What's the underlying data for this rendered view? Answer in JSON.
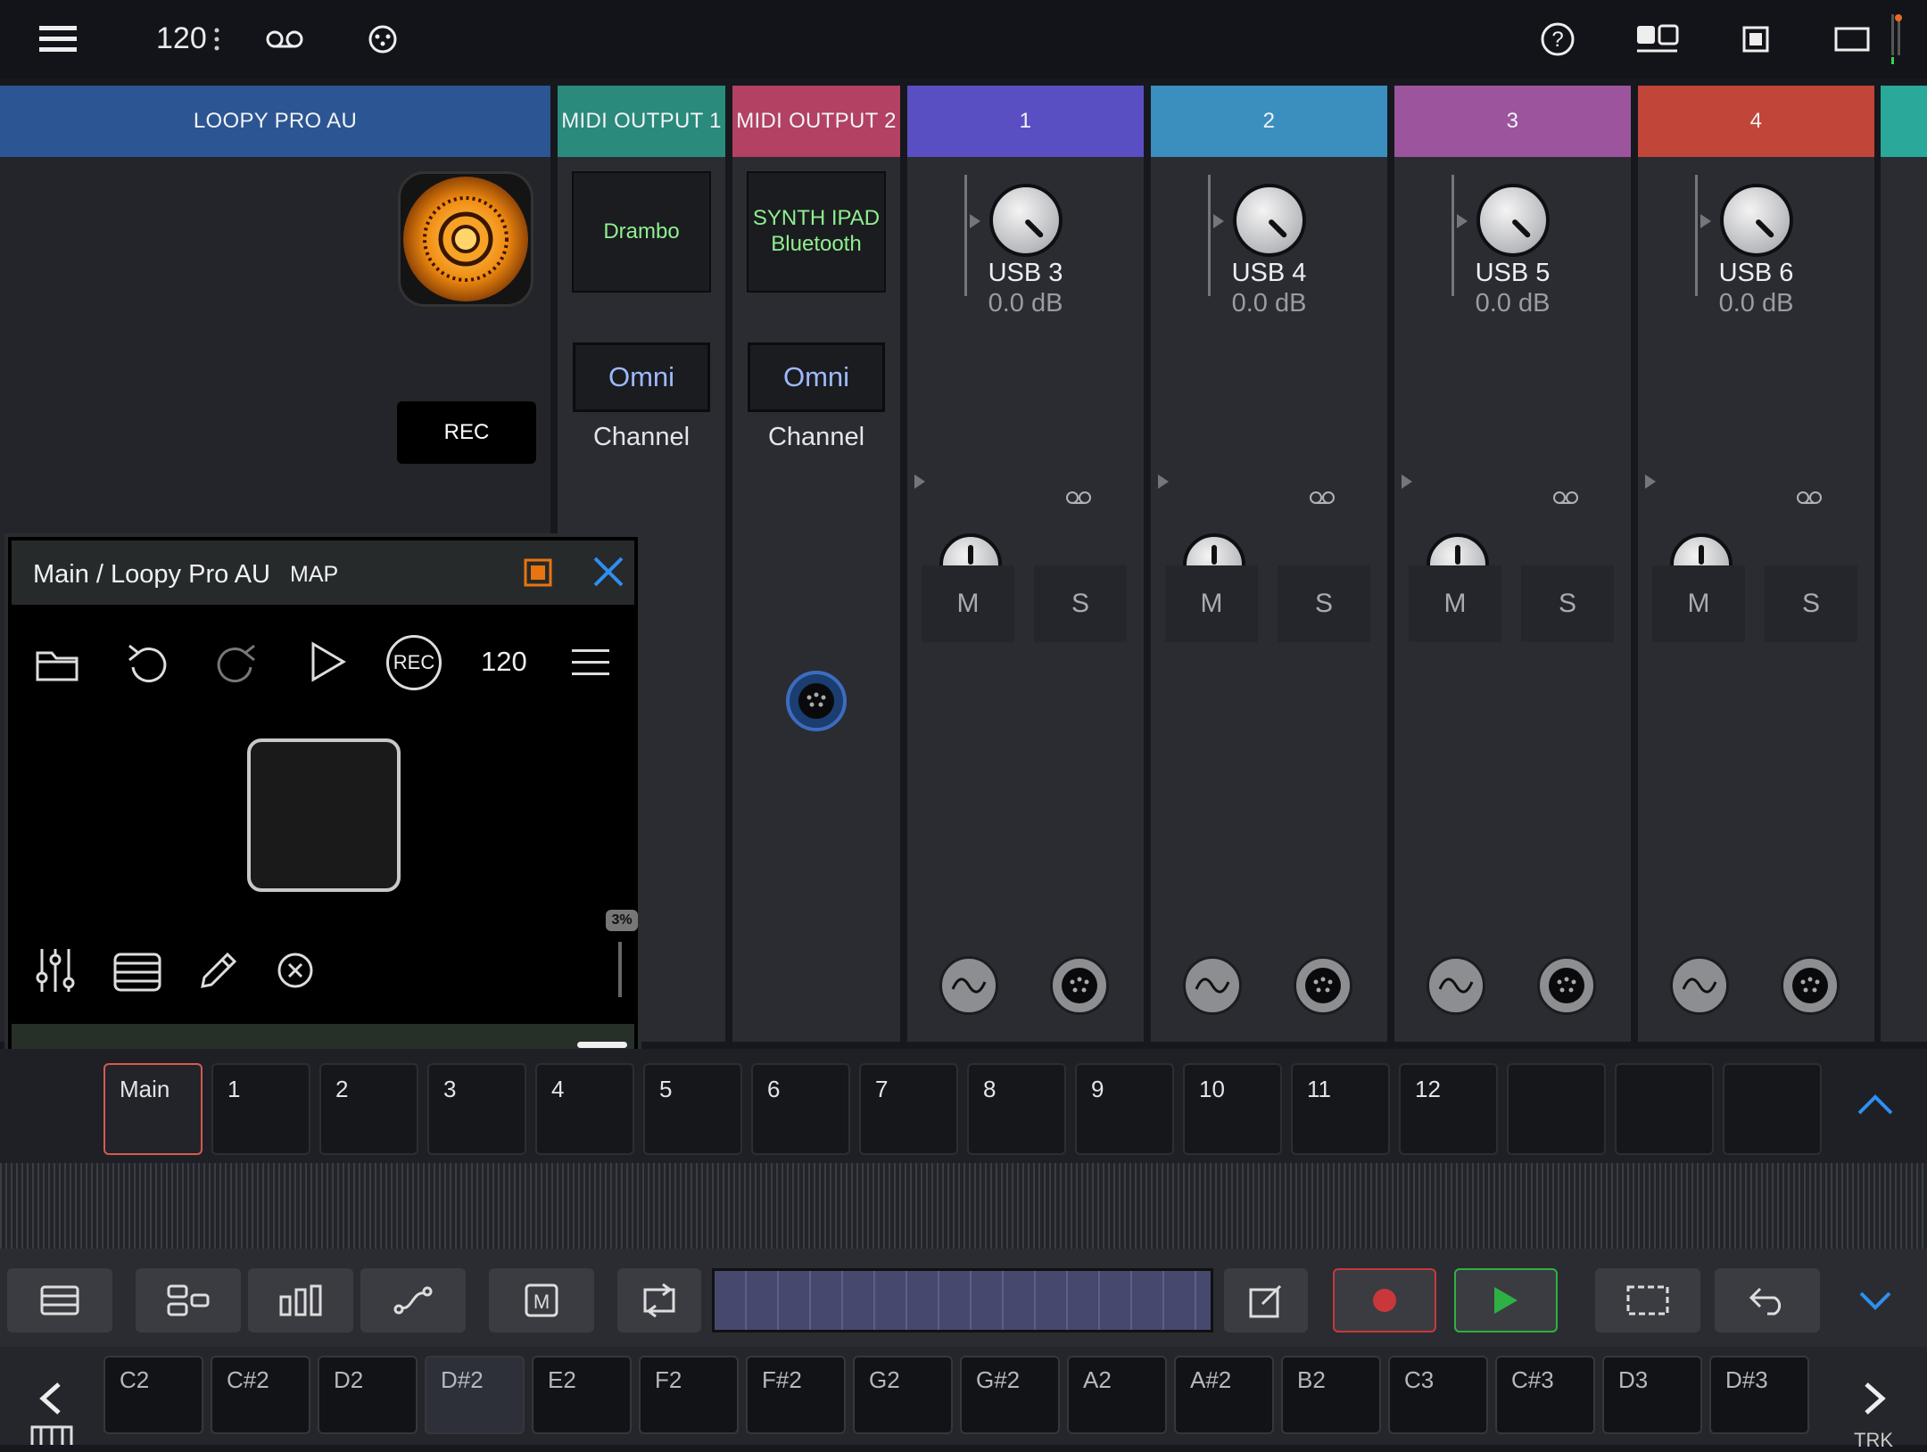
{
  "topbar": {
    "bpm": "120",
    "icons": [
      "menu-icon",
      "bpm-more-icon",
      "loop-icon",
      "dial-icon",
      "help-icon",
      "layout-icon",
      "single-view-icon",
      "fullscreen-icon"
    ]
  },
  "strips": {
    "au": {
      "title": "LOOPY PRO AU",
      "rec_label": "REC"
    },
    "midi1": {
      "title": "MIDI OUTPUT 1",
      "device": "Drambo",
      "channel_value": "Omni",
      "channel_label": "Channel",
      "color": "#2a8a7c"
    },
    "midi2": {
      "title": "MIDI OUTPUT 2",
      "device_line1": "SYNTH IPAD",
      "device_line2": "Bluetooth",
      "channel_value": "Omni",
      "channel_label": "Channel",
      "color": "#b24163"
    },
    "channels": [
      {
        "num": "1",
        "input": "USB 3",
        "gain": "0.0 dB",
        "pan": "Pan",
        "mute": "M",
        "solo": "S",
        "color": "#5a4fc2"
      },
      {
        "num": "2",
        "input": "USB 4",
        "gain": "0.0 dB",
        "pan": "Pan",
        "mute": "M",
        "solo": "S",
        "color": "#3a8fbf"
      },
      {
        "num": "3",
        "input": "USB 5",
        "gain": "0.0 dB",
        "pan": "Pan",
        "mute": "M",
        "solo": "S",
        "color": "#9c549c"
      },
      {
        "num": "4",
        "input": "USB 6",
        "gain": "0.0 dB",
        "pan": "Pan",
        "mute": "M",
        "solo": "S",
        "color": "#c2453a"
      }
    ]
  },
  "plugin": {
    "title": "Main / Loopy Pro AU",
    "map": "MAP",
    "bpm": "120",
    "rec": "REC",
    "percent": "3%"
  },
  "scenes": [
    "Main",
    "1",
    "2",
    "3",
    "4",
    "5",
    "6",
    "7",
    "8",
    "9",
    "10",
    "11",
    "12",
    "",
    "",
    ""
  ],
  "keys": [
    "C2",
    "C#2",
    "D2",
    "D#2",
    "E2",
    "F2",
    "F#2",
    "G2",
    "G#2",
    "A2",
    "A#2",
    "B2",
    "C3",
    "C#3",
    "D3",
    "D#3"
  ],
  "footer": {
    "trk": "TRK"
  }
}
